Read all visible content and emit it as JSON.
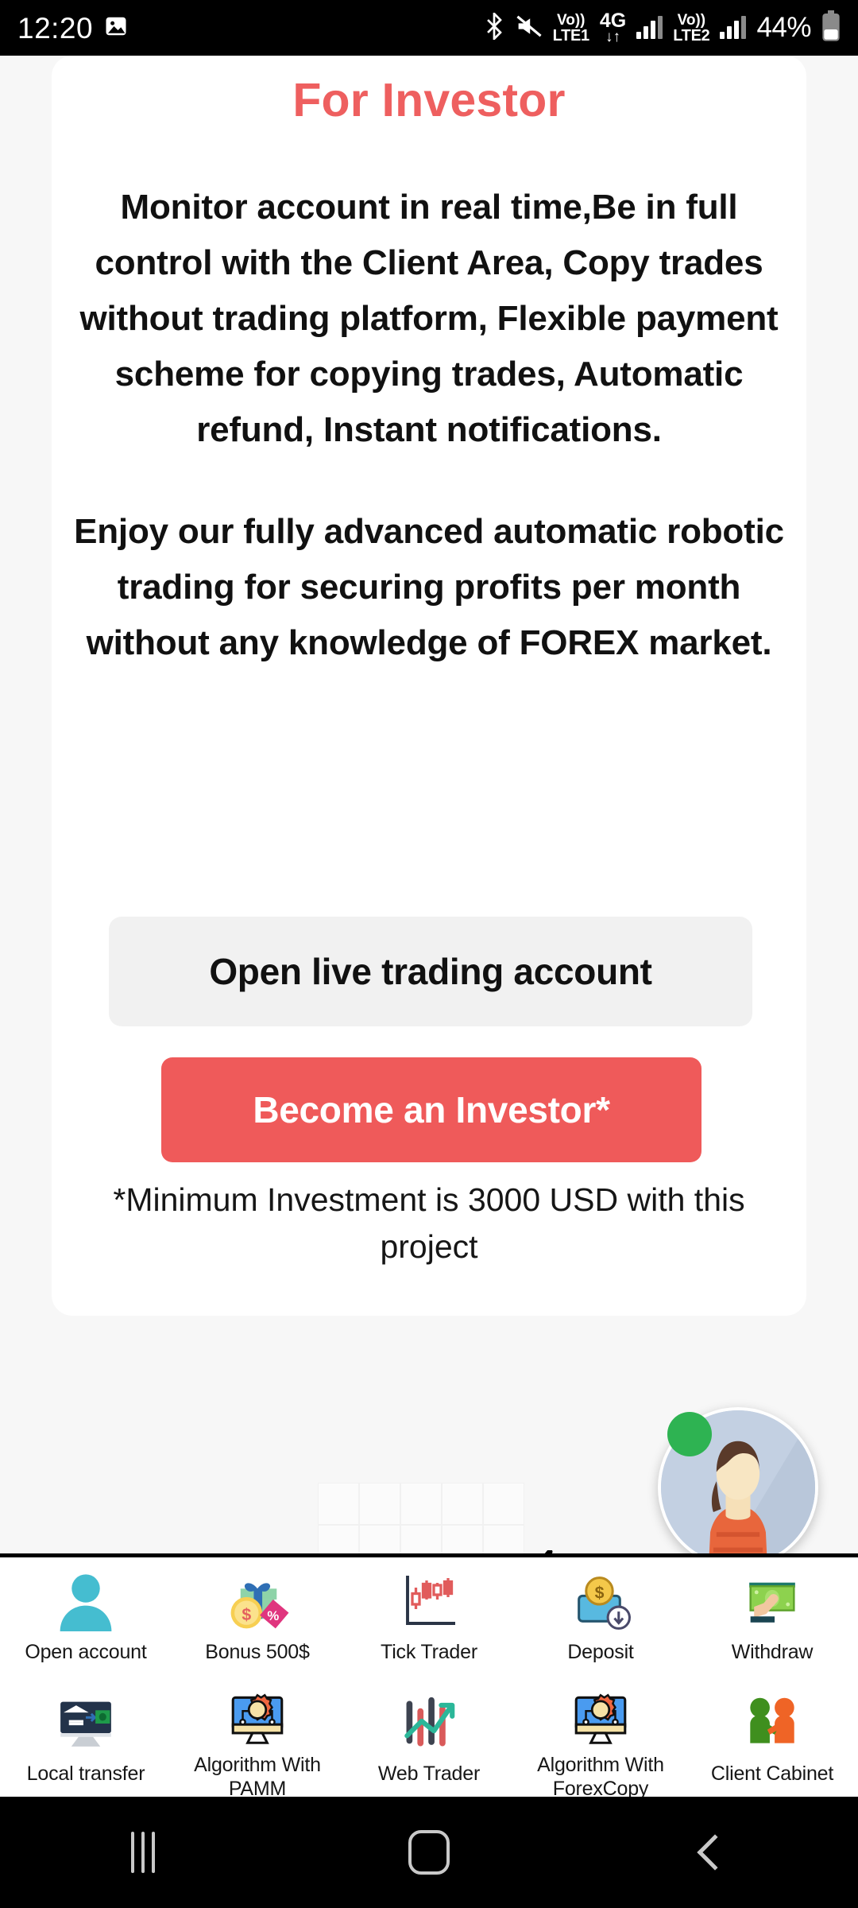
{
  "statusbar": {
    "clock": "12:20",
    "photo_icon": "image-icon",
    "bluetooth_icon": "bluetooth-icon",
    "mute_icon": "mute-icon",
    "sim1_volte_top": "Vo))",
    "sim1_volte_bottom": "LTE1",
    "network_type": "4G",
    "data_arrows": "↓↑",
    "sim2_volte_top": "Vo))",
    "sim2_volte_bottom": "LTE2",
    "battery_percent": "44%"
  },
  "card": {
    "title": "For Investor",
    "paragraph1": "Monitor account in real time,Be in full control with the Client Area, Copy trades without trading platform, Flexible payment scheme for copying trades, Automatic refund, Instant notifications.",
    "paragraph2": "Enjoy our fully advanced automatic robotic trading for securing profits per month without any knowledge of FOREX market.",
    "secondary_button": "Open live trading account",
    "primary_button": "Become an Investor*",
    "footnote": "*Minimum Investment is 3000 USD with this project"
  },
  "chat": {
    "avatar": "support-agent-avatar",
    "status": "online",
    "status_color": "#2eb352"
  },
  "colors": {
    "accent": "#ef5a5a",
    "title": "#ee5f5f",
    "page_bg": "#f7f7f7",
    "card_bg": "#ffffff",
    "ghost_button_bg": "#f1f1f1"
  },
  "icon_grid": {
    "rows": [
      [
        {
          "label": "Open account",
          "icon": "user-account-icon"
        },
        {
          "label": "Bonus 500$",
          "icon": "gift-bonus-icon"
        },
        {
          "label": "Tick Trader",
          "icon": "candlestick-chart-icon"
        },
        {
          "label": "Deposit",
          "icon": "deposit-wallet-icon"
        },
        {
          "label": "Withdraw",
          "icon": "withdraw-cash-icon"
        }
      ],
      [
        {
          "label": "Local transfer",
          "icon": "bank-transfer-monitor-icon"
        },
        {
          "label": "Algorithm With PAMM",
          "icon": "algorithm-monitor-gear-icon"
        },
        {
          "label": "Web Trader",
          "icon": "trend-arrow-chart-icon"
        },
        {
          "label": "Algorithm With ForexCopy",
          "icon": "algorithm-monitor-gear-icon"
        },
        {
          "label": "Client Cabinet",
          "icon": "handshake-people-icon"
        }
      ]
    ]
  },
  "navbar": {
    "recents": "recents-icon",
    "home": "home-icon",
    "back": "back-icon"
  }
}
